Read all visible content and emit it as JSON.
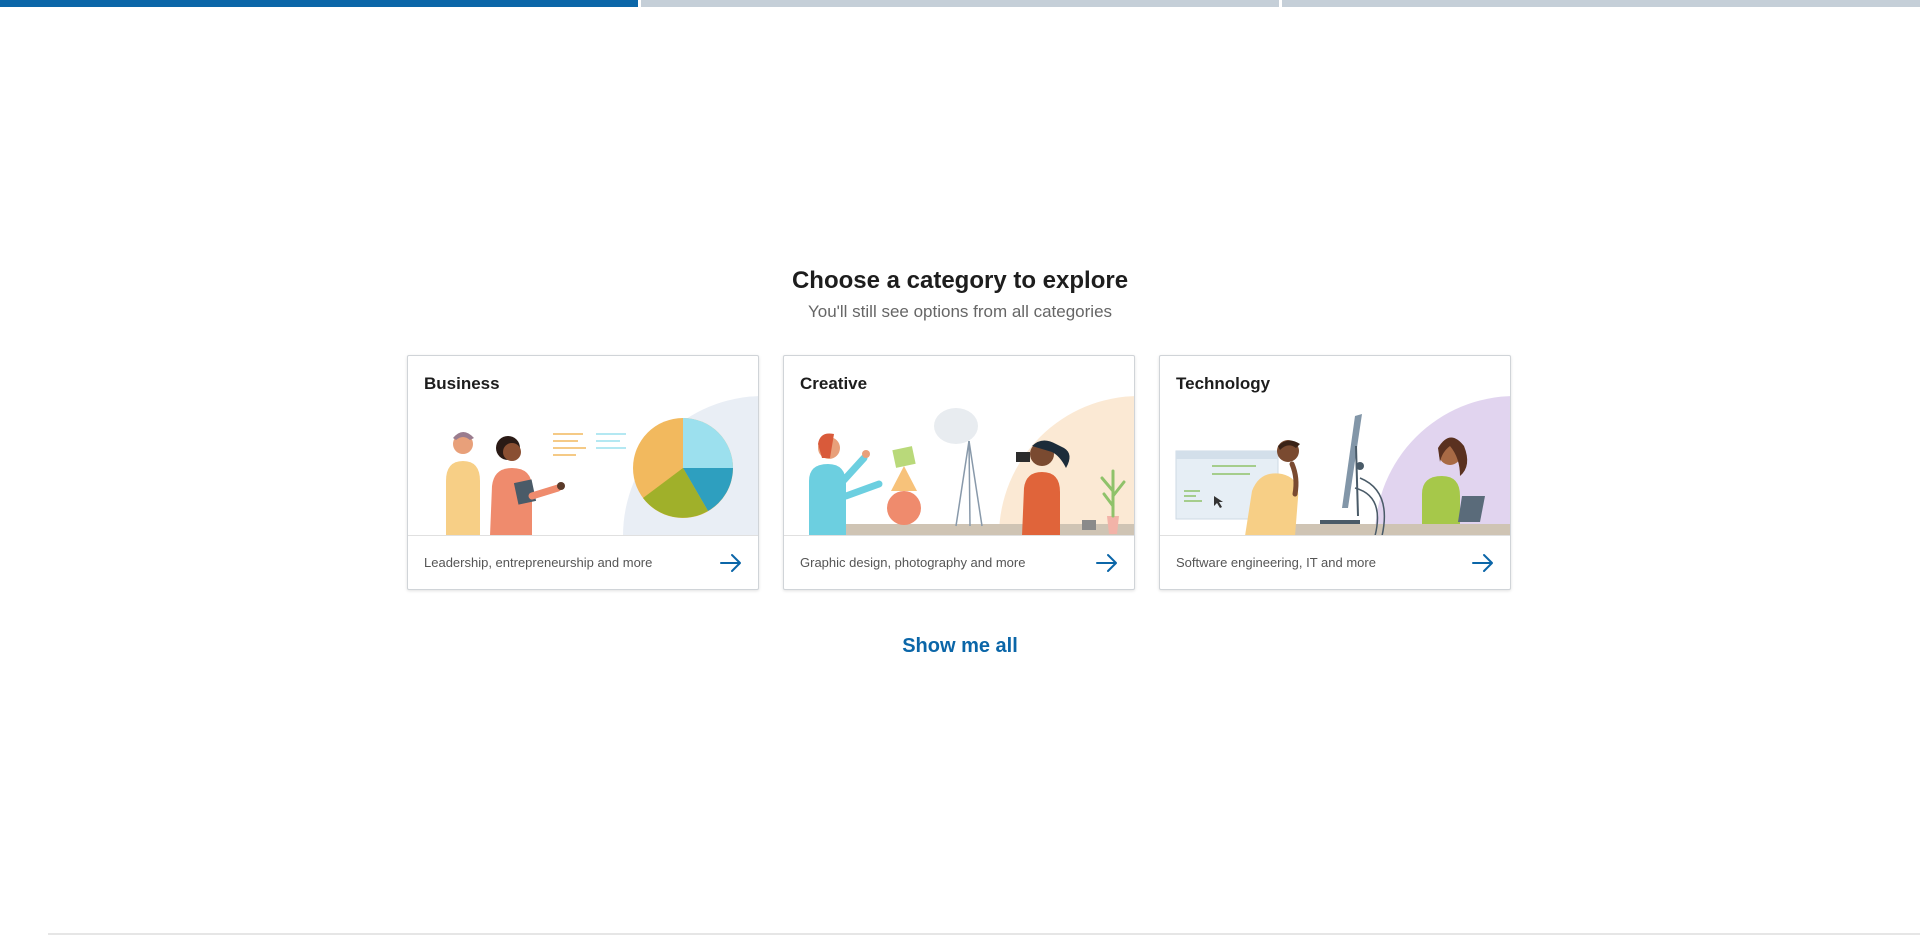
{
  "progress": {
    "total_steps": 3,
    "current_step": 1
  },
  "header": {
    "title": "Choose a category to explore",
    "subtitle": "You'll still see options from all categories"
  },
  "categories": [
    {
      "title": "Business",
      "description": "Leadership, entrepreneurship and more",
      "icon": "arrow-right-icon"
    },
    {
      "title": "Creative",
      "description": "Graphic design, photography and more",
      "icon": "arrow-right-icon"
    },
    {
      "title": "Technology",
      "description": "Software engineering, IT and more",
      "icon": "arrow-right-icon"
    }
  ],
  "show_all_label": "Show me all",
  "colors": {
    "accent": "#0b66a8",
    "progress_inactive": "#c5cfd8",
    "business_bg": "#e9eef5",
    "creative_bg": "#fbe9d4",
    "technology_bg": "#e1d4ef"
  }
}
